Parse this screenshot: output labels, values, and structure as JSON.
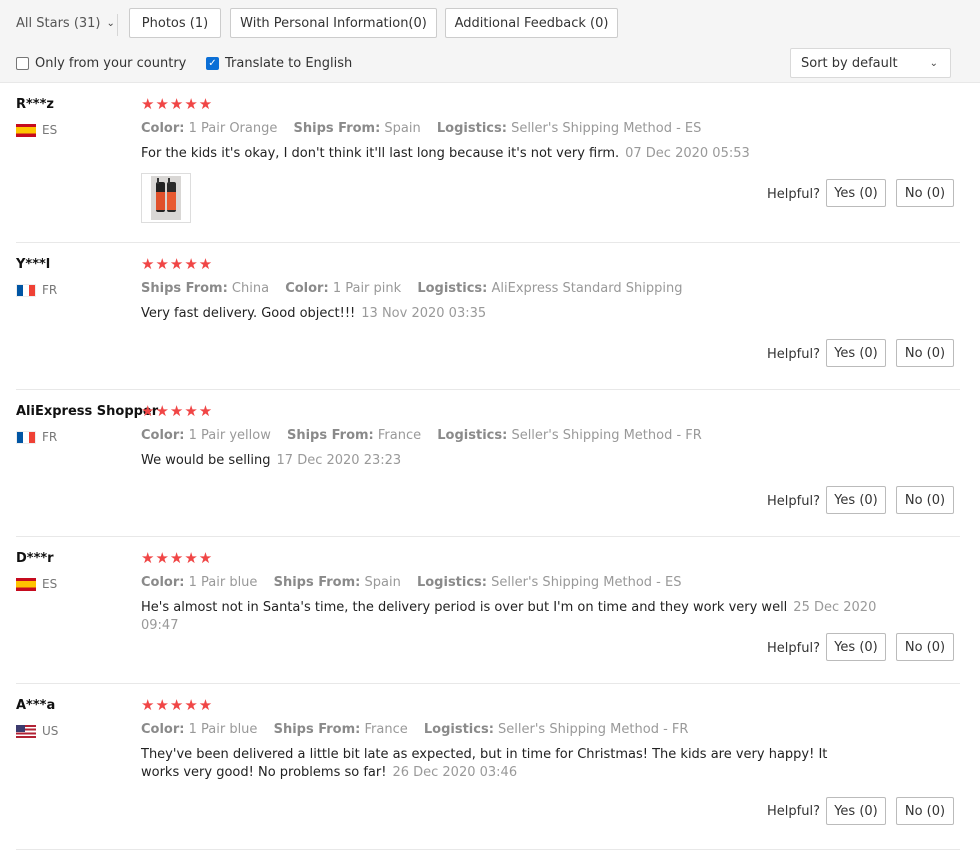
{
  "filters": {
    "stars_label": "All Stars (31)",
    "photos_label": "Photos (1)",
    "personal_label": "With Personal Information(0)",
    "additional_label": "Additional Feedback (0)",
    "only_country_label": "Only from your country",
    "only_country_checked": false,
    "translate_label": "Translate to English",
    "translate_checked": true,
    "sort_value": "Sort by default"
  },
  "helpful_label": "Helpful?",
  "stars_glyphs": "★★★★★",
  "star_color": "#f04646",
  "reviews": [
    {
      "user": "R***z",
      "country": "ES",
      "flag": "flag-es",
      "stars": 5,
      "meta": [
        [
          "Color:",
          "1 Pair Orange"
        ],
        [
          "Ships From:",
          "Spain"
        ],
        [
          "Logistics:",
          "Seller's Shipping Method - ES"
        ]
      ],
      "text": "For the kids it's okay, I don't think it'll last long because it's not very firm.",
      "date": "07 Dec 2020 05:53",
      "yes": "Yes (0)",
      "no": "No (0)"
    },
    {
      "user": "Y***l",
      "country": "FR",
      "flag": "flag-fr",
      "stars": 5,
      "meta": [
        [
          "Ships From:",
          "China"
        ],
        [
          "Color:",
          "1 Pair pink"
        ],
        [
          "Logistics:",
          "AliExpress Standard Shipping"
        ]
      ],
      "text": "Very fast delivery. Good object!!!",
      "date": "13 Nov 2020 03:35",
      "yes": "Yes (0)",
      "no": "No (0)"
    },
    {
      "user": "AliExpress Shopper",
      "country": "FR",
      "flag": "flag-fr",
      "stars": 5,
      "meta": [
        [
          "Color:",
          "1 Pair yellow"
        ],
        [
          "Ships From:",
          "France"
        ],
        [
          "Logistics:",
          "Seller's Shipping Method - FR"
        ]
      ],
      "text": "We would be selling",
      "date": "17 Dec 2020 23:23",
      "yes": "Yes (0)",
      "no": "No (0)"
    },
    {
      "user": "D***r",
      "country": "ES",
      "flag": "flag-es",
      "stars": 5,
      "meta": [
        [
          "Color:",
          "1 Pair blue"
        ],
        [
          "Ships From:",
          "Spain"
        ],
        [
          "Logistics:",
          "Seller's Shipping Method - ES"
        ]
      ],
      "text": "He's almost not in Santa's time, the delivery period is over but I'm on time and they work very well",
      "date": "25 Dec 2020 09:47",
      "yes": "Yes (0)",
      "no": "No (0)"
    },
    {
      "user": "A***a",
      "country": "US",
      "flag": "flag-us",
      "stars": 5,
      "meta": [
        [
          "Color:",
          "1 Pair blue"
        ],
        [
          "Ships From:",
          "France"
        ],
        [
          "Logistics:",
          "Seller's Shipping Method - FR"
        ]
      ],
      "text": "They've been delivered a little bit late as expected, but in time for Christmas! The kids are very happy! It works very good! No problems so far!",
      "date": "26 Dec 2020 03:46",
      "yes": "Yes (0)",
      "no": "No (0)"
    }
  ]
}
